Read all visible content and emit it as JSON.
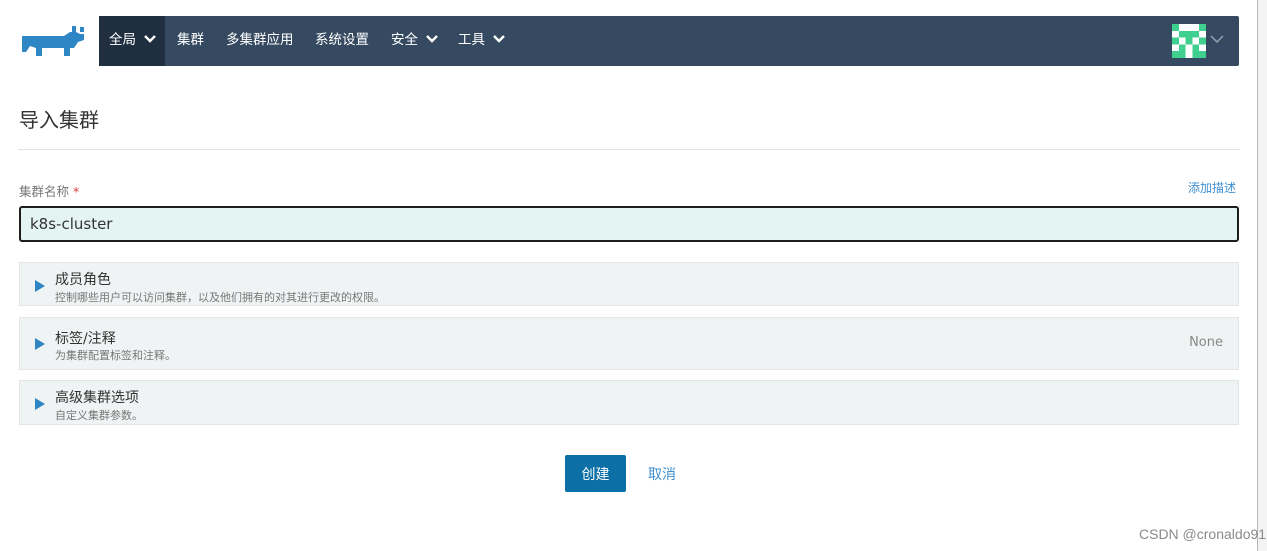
{
  "nav": {
    "items": [
      {
        "label": "全局",
        "has_dropdown": true,
        "active": true
      },
      {
        "label": "集群",
        "has_dropdown": false,
        "active": false
      },
      {
        "label": "多集群应用",
        "has_dropdown": false,
        "active": false
      },
      {
        "label": "系统设置",
        "has_dropdown": false,
        "active": false
      },
      {
        "label": "安全",
        "has_dropdown": true,
        "active": false
      },
      {
        "label": "工具",
        "has_dropdown": true,
        "active": false
      }
    ],
    "logo_icon": "rancher-cow-logo",
    "avatar_icon": "identicon-avatar",
    "background": "#354a60",
    "active_background": "#1f2f40"
  },
  "page": {
    "title": "导入集群"
  },
  "form": {
    "cluster_name_label": "集群名称",
    "required_mark": "*",
    "add_description_link": "添加描述",
    "cluster_name_value": "k8s-cluster",
    "input_background": "#e3f4f3"
  },
  "sections": [
    {
      "title": "成员角色",
      "subtitle": "控制哪些用户可以访问集群，以及他们拥有的对其进行更改的权限。",
      "status": ""
    },
    {
      "title": "标签/注释",
      "subtitle": "为集群配置标签和注释。",
      "status": "None"
    },
    {
      "title": "高级集群选项",
      "subtitle": "自定义集群参数。",
      "status": ""
    }
  ],
  "actions": {
    "create_label": "创建",
    "cancel_label": "取消",
    "primary_color": "#0c6fa5",
    "link_color": "#3d8fd1"
  },
  "watermark": "CSDN @cronaldo91"
}
